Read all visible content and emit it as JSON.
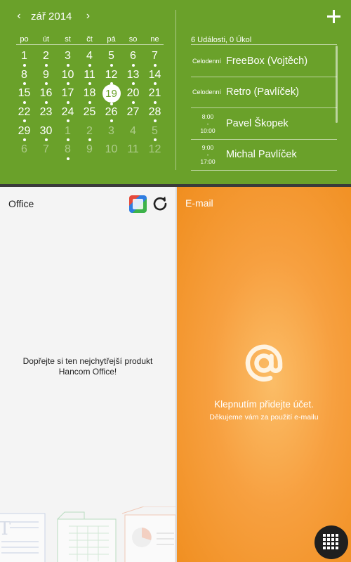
{
  "calendar": {
    "month_label": "zář 2014",
    "prev_arrow": "‹",
    "next_arrow": "›",
    "weekdays": [
      "po",
      "út",
      "st",
      "čt",
      "pá",
      "so",
      "ne"
    ],
    "weeks": [
      [
        {
          "d": "1",
          "dot": true
        },
        {
          "d": "2",
          "dot": true
        },
        {
          "d": "3",
          "dot": true
        },
        {
          "d": "4",
          "dot": true
        },
        {
          "d": "5",
          "dot": true
        },
        {
          "d": "6",
          "dot": true
        },
        {
          "d": "7",
          "dot": true
        }
      ],
      [
        {
          "d": "8",
          "dot": true
        },
        {
          "d": "9",
          "dot": true
        },
        {
          "d": "10",
          "dot": true
        },
        {
          "d": "11",
          "dot": true
        },
        {
          "d": "12",
          "dot": true
        },
        {
          "d": "13",
          "dot": true
        },
        {
          "d": "14",
          "dot": true
        }
      ],
      [
        {
          "d": "15",
          "dot": true
        },
        {
          "d": "16",
          "dot": true
        },
        {
          "d": "17",
          "dot": true
        },
        {
          "d": "18",
          "dot": true
        },
        {
          "d": "19",
          "dot": true,
          "today": true
        },
        {
          "d": "20",
          "dot": true
        },
        {
          "d": "21",
          "dot": true
        }
      ],
      [
        {
          "d": "22",
          "dot": true
        },
        {
          "d": "23",
          "dot": false
        },
        {
          "d": "24",
          "dot": true
        },
        {
          "d": "25",
          "dot": false
        },
        {
          "d": "26",
          "dot": true
        },
        {
          "d": "27",
          "dot": false
        },
        {
          "d": "28",
          "dot": true
        }
      ],
      [
        {
          "d": "29",
          "dot": true
        },
        {
          "d": "30",
          "dot": true
        },
        {
          "d": "1",
          "dot": true,
          "muted": true
        },
        {
          "d": "2",
          "dot": true,
          "muted": true
        },
        {
          "d": "3",
          "dot": false,
          "muted": true
        },
        {
          "d": "4",
          "dot": false,
          "muted": true
        },
        {
          "d": "5",
          "dot": true,
          "muted": true
        }
      ],
      [
        {
          "d": "6",
          "dot": false,
          "muted": true
        },
        {
          "d": "7",
          "dot": false,
          "muted": true
        },
        {
          "d": "8",
          "dot": true,
          "muted": true
        },
        {
          "d": "9",
          "dot": false,
          "muted": true
        },
        {
          "d": "10",
          "dot": false,
          "muted": true
        },
        {
          "d": "11",
          "dot": false,
          "muted": true
        },
        {
          "d": "12",
          "dot": false,
          "muted": true
        }
      ]
    ],
    "summary": "6 Události,  0 Úkol",
    "add_icon": "plus-icon",
    "events": [
      {
        "time": "Celodenní",
        "allday": true,
        "title": "FreeBox (Vojtěch)"
      },
      {
        "time": "Celodenní",
        "allday": true,
        "title": "Retro (Pavlíček)"
      },
      {
        "time_start": "8:00",
        "time_sep": "-",
        "time_end": "10:00",
        "allday": false,
        "title": "Pavel Škopek"
      },
      {
        "time_start": "9:00",
        "time_sep": "-",
        "time_end": "17:00",
        "allday": false,
        "title": "Michal Pavlíček"
      }
    ]
  },
  "office": {
    "title": "Office",
    "message_line1": "Dopřejte si ten nejchytřejší produkt",
    "message_line2": "Hancom Office!",
    "icons": [
      "hancom-office-icon",
      "refresh-icon",
      "documents-illustration"
    ]
  },
  "email": {
    "title": "E-mail",
    "main_text": "Klepnutím přidejte účet.",
    "sub_text": "Děkujeme vám za použití e-mailu",
    "icon": "at-sign-icon"
  },
  "apps_button": {
    "icon": "apps-grid-icon"
  },
  "colors": {
    "calendar_bg": "#6aa12a",
    "email_orange": "#f7a040",
    "office_bg": "#f4f4f4"
  }
}
